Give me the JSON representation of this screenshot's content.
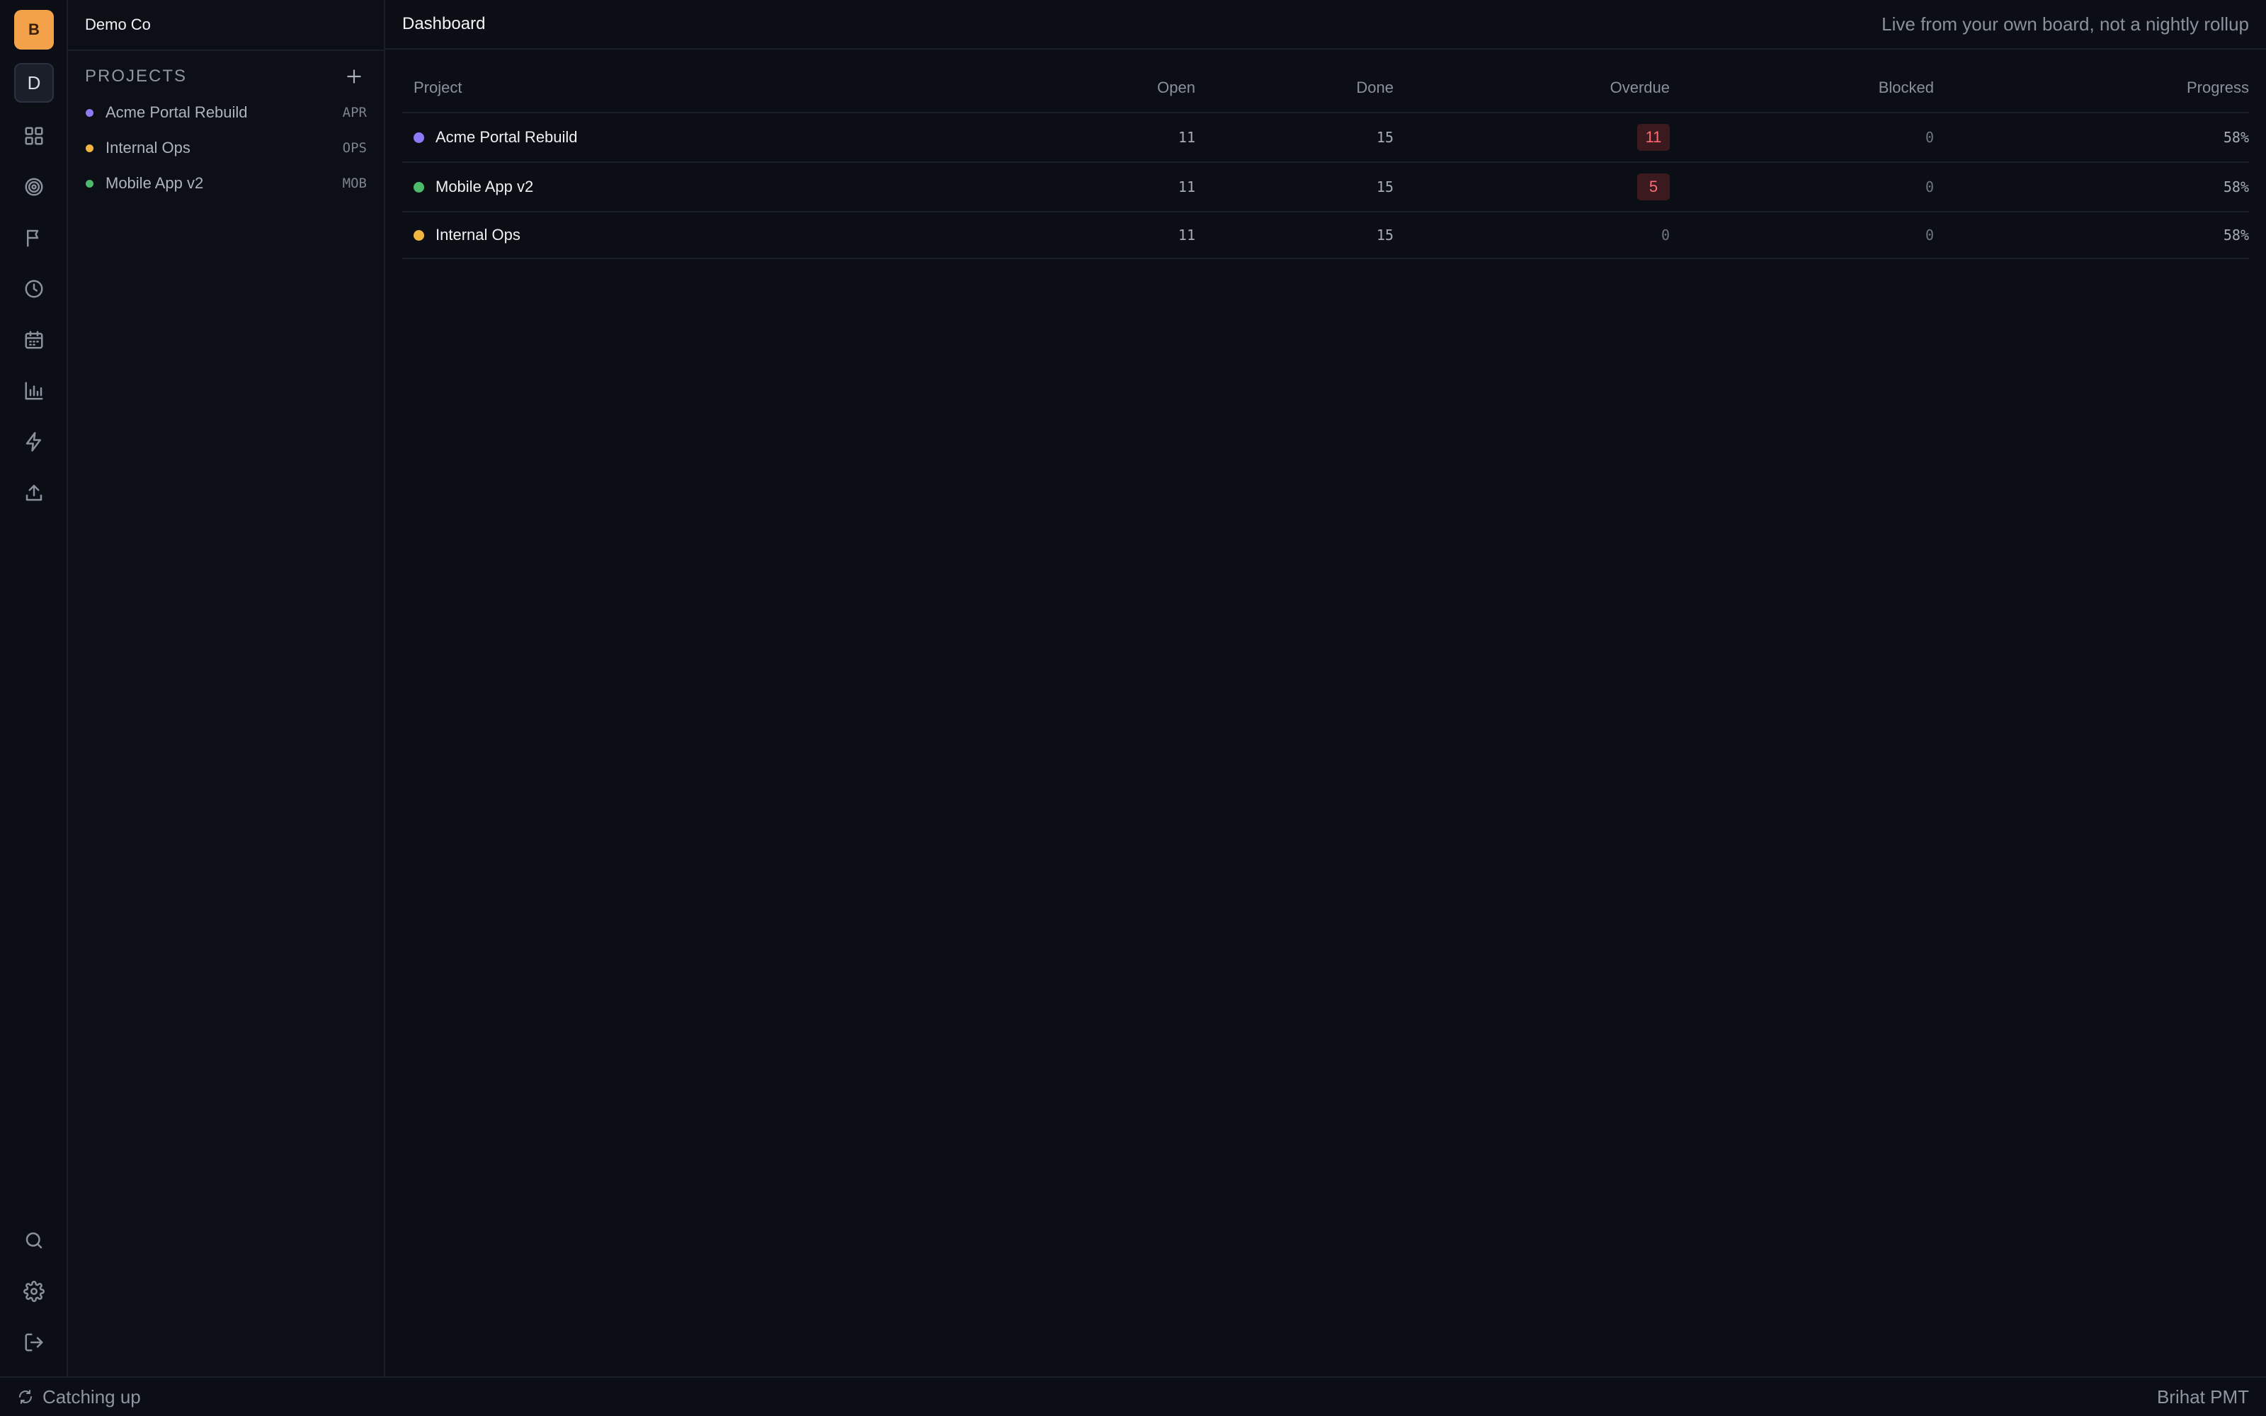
{
  "rail": {
    "logo_letter": "B",
    "workspace_letter": "D",
    "logo_color": "#f4a24a",
    "nav_icons": [
      "grid-icon",
      "target-icon",
      "flag-icon",
      "clock-icon",
      "calendar-icon",
      "bar-chart-icon",
      "bolt-icon",
      "upload-icon"
    ],
    "bottom_icons": [
      "search-icon",
      "gear-icon",
      "logout-icon"
    ]
  },
  "sidebar": {
    "org_name": "Demo Co",
    "projects_heading": "PROJECTS",
    "projects": [
      {
        "name": "Acme Portal Rebuild",
        "key": "APR",
        "color": "#8b7cf6"
      },
      {
        "name": "Internal Ops",
        "key": "OPS",
        "color": "#f2b640"
      },
      {
        "name": "Mobile App v2",
        "key": "MOB",
        "color": "#4cbb6c"
      }
    ]
  },
  "header": {
    "title": "Dashboard",
    "tagline": "Live from your own board, not a nightly rollup"
  },
  "table": {
    "columns": {
      "project": "Project",
      "open": "Open",
      "done": "Done",
      "overdue": "Overdue",
      "blocked": "Blocked",
      "progress": "Progress"
    },
    "rows": [
      {
        "name": "Acme Portal Rebuild",
        "color": "#8b7cf6",
        "open": "11",
        "done": "15",
        "overdue": "11",
        "blocked": "0",
        "progress": "58%"
      },
      {
        "name": "Mobile App v2",
        "color": "#4cbb6c",
        "open": "11",
        "done": "15",
        "overdue": "5",
        "blocked": "0",
        "progress": "58%"
      },
      {
        "name": "Internal Ops",
        "color": "#f2b640",
        "open": "11",
        "done": "15",
        "overdue": "0",
        "blocked": "0",
        "progress": "58%"
      }
    ]
  },
  "status": {
    "sync_text": "Catching up",
    "app_name": "Brihat PMT"
  }
}
